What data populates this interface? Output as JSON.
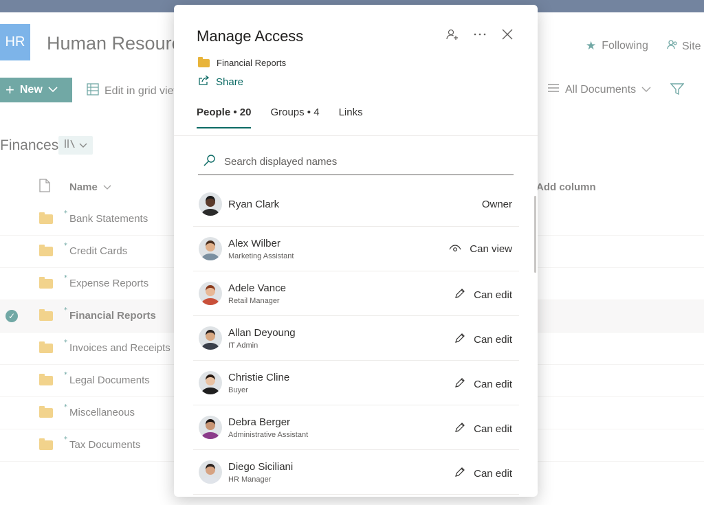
{
  "site": {
    "tile_text": "HR",
    "title": "Human Resources",
    "following_label": "Following",
    "site_label": "Site"
  },
  "commandbar": {
    "new_label": "New",
    "grid_label": "Edit in grid view",
    "view_label": "All Documents"
  },
  "library": {
    "title": "Finances",
    "columns": {
      "name": "Name",
      "add": "Add column"
    },
    "items": [
      {
        "name": "Bank Statements",
        "selected": false
      },
      {
        "name": "Credit Cards",
        "selected": false
      },
      {
        "name": "Expense Reports",
        "selected": false
      },
      {
        "name": "Financial Reports",
        "selected": true
      },
      {
        "name": "Invoices and Receipts",
        "selected": false
      },
      {
        "name": "Legal Documents",
        "selected": false
      },
      {
        "name": "Miscellaneous",
        "selected": false
      },
      {
        "name": "Tax Documents",
        "selected": false
      }
    ]
  },
  "panel": {
    "title": "Manage Access",
    "file_name": "Financial Reports",
    "share_label": "Share",
    "tabs": [
      {
        "label": "People • 20",
        "active": true
      },
      {
        "label": "Groups • 4",
        "active": false
      },
      {
        "label": "Links",
        "active": false
      }
    ],
    "search_placeholder": "Search displayed names",
    "people": [
      {
        "name": "Ryan Clark",
        "title": "",
        "role": "Owner",
        "role_icon": "",
        "skin": "#5a3a2a",
        "hair": "#1b1b1b",
        "shirt": "#2b2b2b"
      },
      {
        "name": "Alex Wilber",
        "title": "Marketing Assistant",
        "role": "Can view",
        "role_icon": "eye-icon",
        "skin": "#e0b08a",
        "hair": "#4a3020",
        "shirt": "#7a8fa0"
      },
      {
        "name": "Adele Vance",
        "title": "Retail Manager",
        "role": "Can edit",
        "role_icon": "pencil-icon",
        "skin": "#e8b896",
        "hair": "#8a3a1c",
        "shirt": "#c9503a"
      },
      {
        "name": "Allan Deyoung",
        "title": "IT Admin",
        "role": "Can edit",
        "role_icon": "pencil-icon",
        "skin": "#d8a882",
        "hair": "#2a2220",
        "shirt": "#3a3f4a"
      },
      {
        "name": "Christie Cline",
        "title": "Buyer",
        "role": "Can edit",
        "role_icon": "pencil-icon",
        "skin": "#e9c2a3",
        "hair": "#2a1c14",
        "shirt": "#1f1f1f"
      },
      {
        "name": "Debra Berger",
        "title": "Administrative Assistant",
        "role": "Can edit",
        "role_icon": "pencil-icon",
        "skin": "#c89574",
        "hair": "#1c1412",
        "shirt": "#8b3b8a"
      },
      {
        "name": "Diego Siciliani",
        "title": "HR Manager",
        "role": "Can edit",
        "role_icon": "pencil-icon",
        "skin": "#d6a382",
        "hair": "#2c2420",
        "shirt": "#e0e4ea"
      }
    ]
  },
  "colors": {
    "accent": "#0b6a64",
    "topbar": "#0f2b5b",
    "tile": "#1f7fd9",
    "folder": "#e8b43a"
  }
}
